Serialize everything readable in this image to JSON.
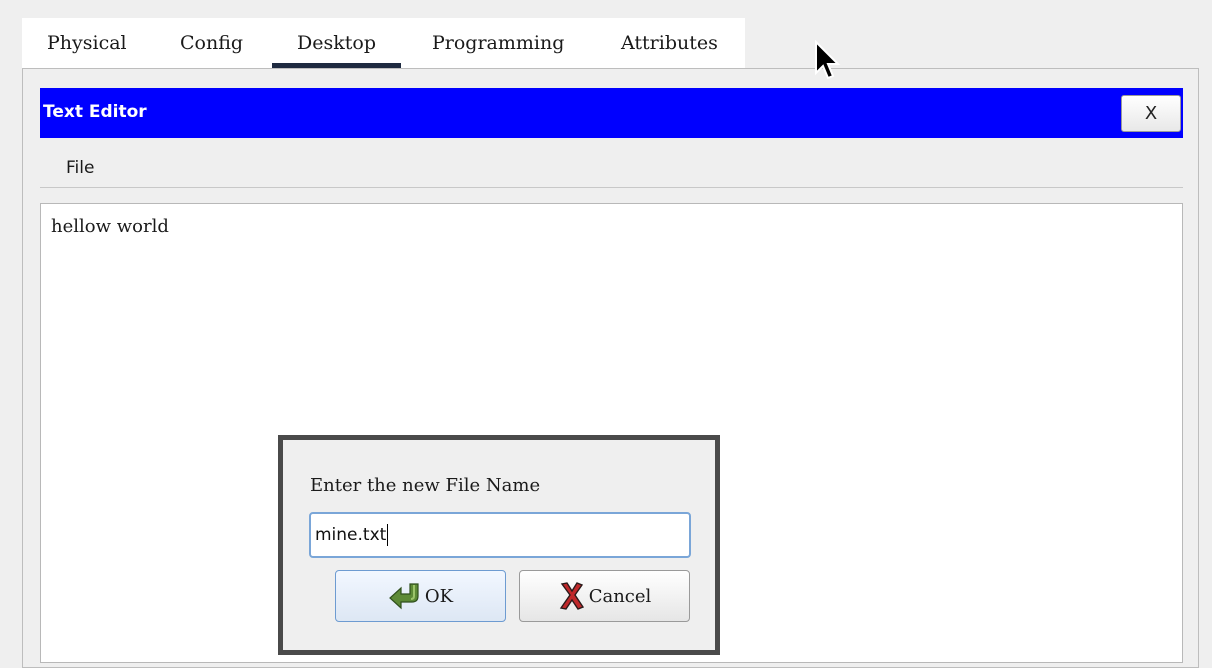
{
  "tabs": [
    {
      "label": "Physical"
    },
    {
      "label": "Config"
    },
    {
      "label": "Desktop",
      "active": true
    },
    {
      "label": "Programming"
    },
    {
      "label": "Attributes"
    }
  ],
  "window": {
    "title": "Text Editor",
    "close_label": "X",
    "title_bar_color": "#0000ff"
  },
  "menu": {
    "file_label": "File"
  },
  "editor": {
    "content": "hellow world"
  },
  "dialog": {
    "prompt": "Enter the new File Name",
    "input_value": "mine.txt",
    "ok_label": "OK",
    "cancel_label": "Cancel",
    "ok_icon": "green-arrow-icon",
    "cancel_icon": "red-x-icon"
  }
}
